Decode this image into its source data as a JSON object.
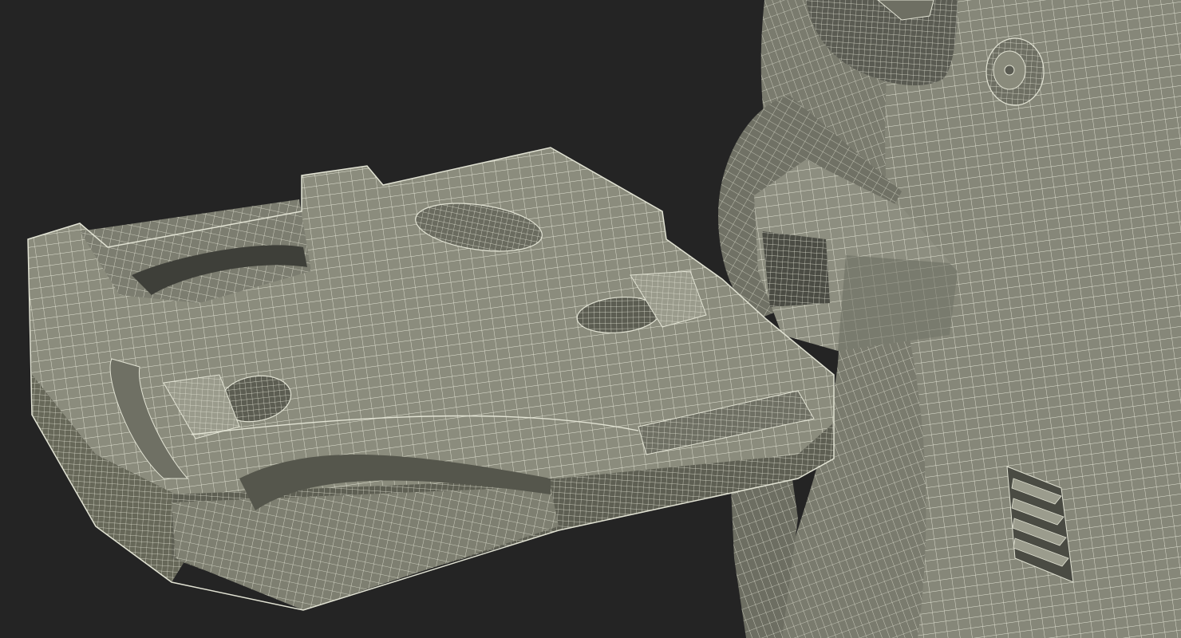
{
  "colors": {
    "background": "#242424",
    "surface_light": "#8a8b7c",
    "surface_mid": "#75766a",
    "surface_dark": "#5a5b52",
    "surface_shadow": "#3c3d38",
    "wire": "#e2e3d4",
    "wire_dim": "#c9cab9"
  },
  "model": {
    "parts": [
      "tray",
      "column",
      "bracket",
      "vent-grille",
      "knob",
      "latch"
    ]
  }
}
